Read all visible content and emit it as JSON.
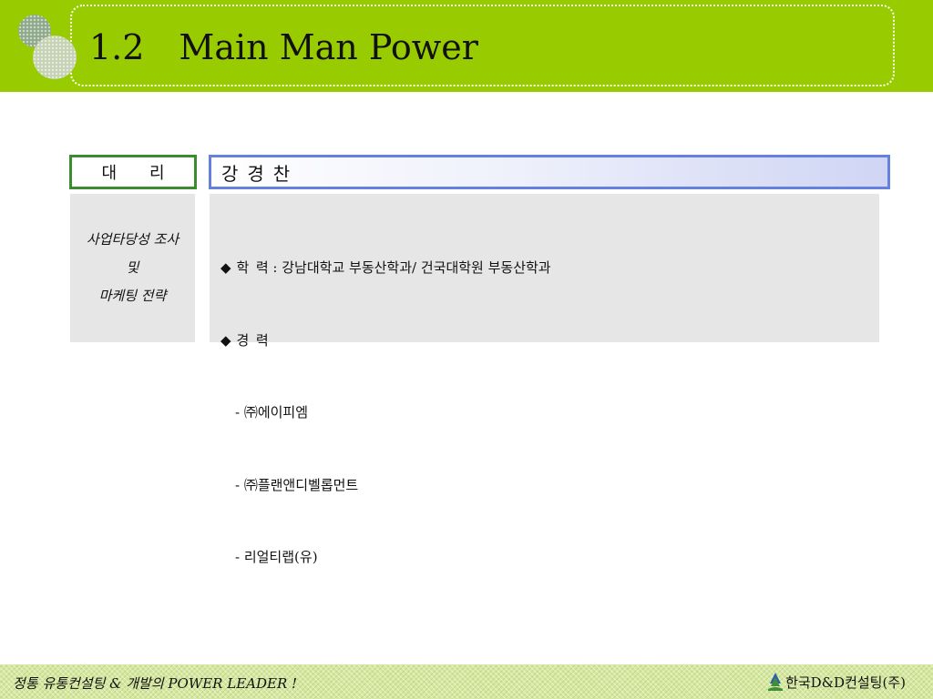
{
  "header": {
    "title": "1.2 Main Man Power"
  },
  "profile": {
    "role": "대　　리",
    "name": "강 경 찬"
  },
  "responsibility": {
    "line1": "사업타당성 조사",
    "line2": "및",
    "line3": "마케팅 전략"
  },
  "details": {
    "bullet_symbol": "◆",
    "education_label": "학 력",
    "education_sep": " : ",
    "education_value": "강남대학교 부동산학과/ 건국대학원 부동산학과",
    "career_label": "경 력",
    "career_items": [
      "- ㈜에이피엠",
      "- ㈜플랜앤디벨롭먼트",
      "- 리얼티랩(유)"
    ]
  },
  "footer": {
    "slogan": "정통 유통컨설팅 & 개발의 POWER LEADER !",
    "company": "한국D&D컨설팅(주)"
  },
  "colors": {
    "header_green": "#99cc00",
    "role_border": "#3a8c2e",
    "name_border": "#6680dd",
    "panel_gray": "#e6e6e6"
  }
}
